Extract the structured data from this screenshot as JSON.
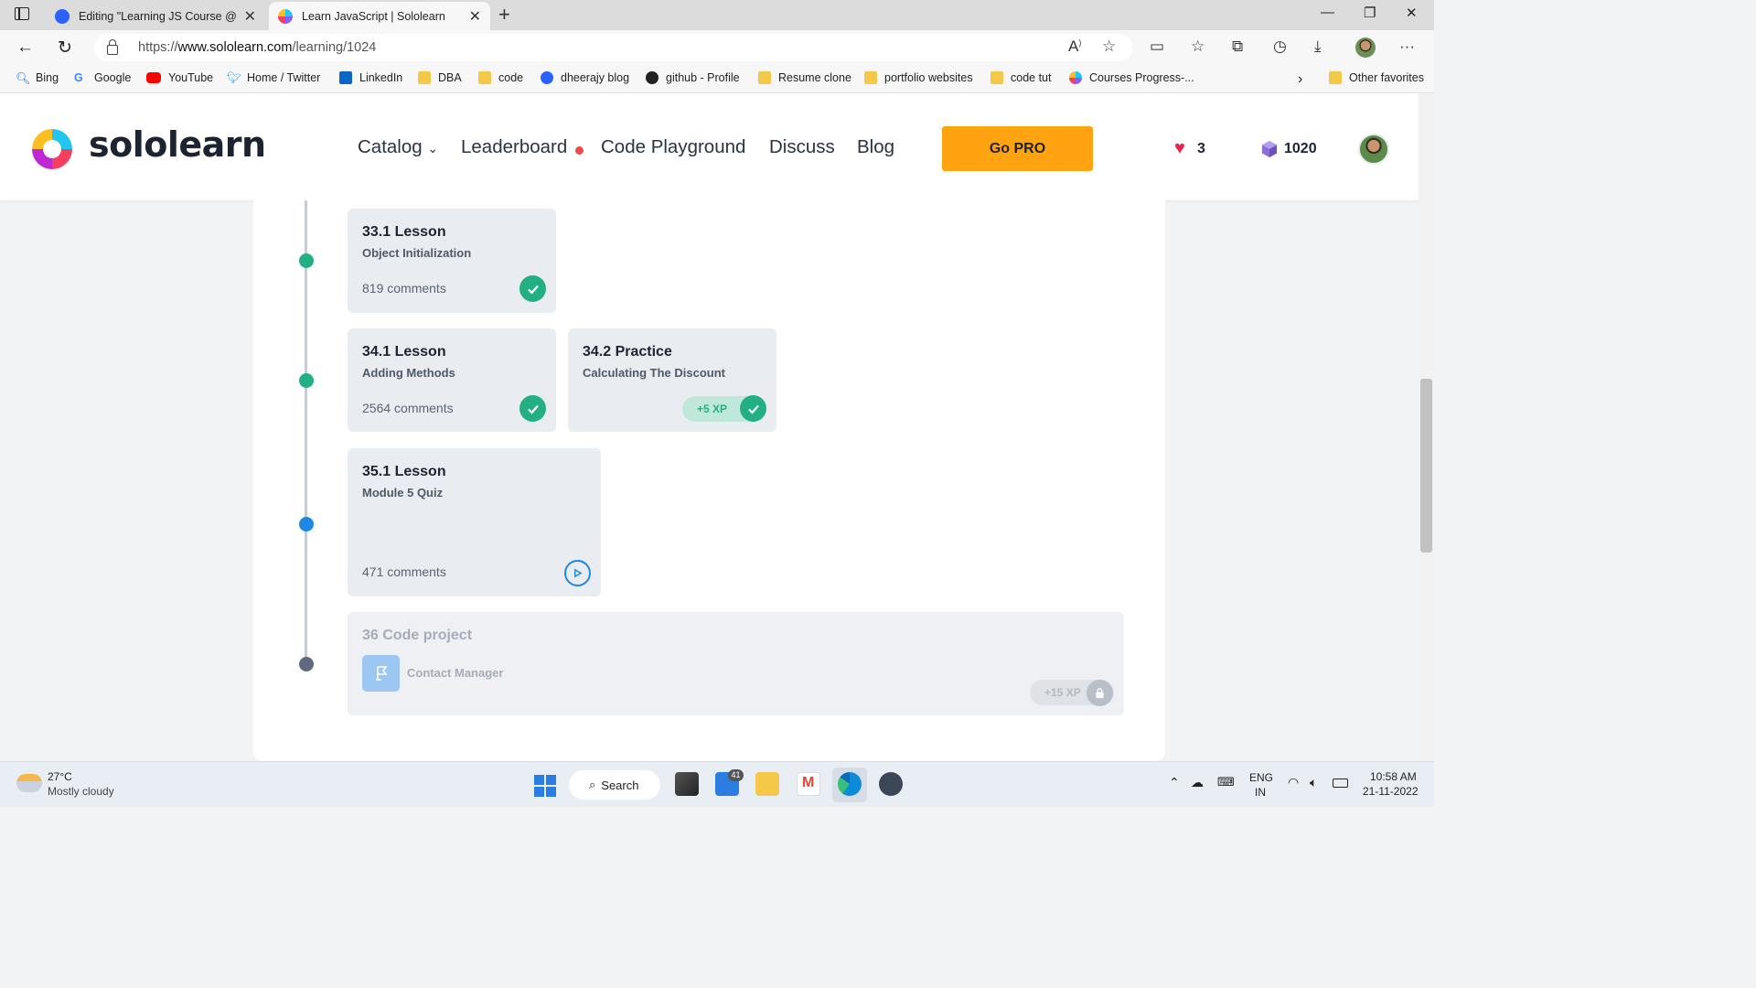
{
  "browser": {
    "tabs": [
      {
        "title": "Editing \"Learning JS Course @Sololearn\"",
        "active": false
      },
      {
        "title": "Learn JavaScript | Sololearn",
        "active": true
      }
    ],
    "url_scheme": "https://",
    "url_host": "www.sololearn.com",
    "url_path": "/learning/1024",
    "bookmarks": [
      "Bing",
      "Google",
      "YouTube",
      "Home / Twitter",
      "LinkedIn",
      "DBA",
      "code",
      "dheerajy blog",
      "github - Profile",
      "Resume clone",
      "portfolio websites",
      "code tut",
      "Courses Progress-...",
      "Other favorites"
    ]
  },
  "site": {
    "logo_text": "sololearn",
    "nav": {
      "catalog": "Catalog",
      "leaderboard": "Leaderboard",
      "code_playground": "Code Playground",
      "discuss": "Discuss",
      "blog": "Blog"
    },
    "go_pro": "Go PRO",
    "hearts": "3",
    "gems": "1020"
  },
  "lessons": {
    "l33_1": {
      "title": "33.1 Lesson",
      "subtitle": "Object Initialization",
      "comments": "819 comments"
    },
    "l34_1": {
      "title": "34.1 Lesson",
      "subtitle": "Adding Methods",
      "comments": "2564 comments"
    },
    "l34_2": {
      "title": "34.2 Practice",
      "subtitle": "Calculating The Discount",
      "xp": "+5 XP"
    },
    "l35_1": {
      "title": "35.1 Lesson",
      "subtitle": "Module 5 Quiz",
      "comments": "471 comments"
    },
    "p36": {
      "title": "36 Code project",
      "subtitle": "Contact Manager",
      "xp": "+15 XP"
    }
  },
  "colors": {
    "brand_orange": "#ffa310",
    "done_green": "#22b083",
    "active_blue": "#1e88e5",
    "locked_gray": "#5f6b7d"
  },
  "taskbar": {
    "weather_temp": "27°C",
    "weather_desc": "Mostly cloudy",
    "search_label": "Search",
    "mail_badge": "41",
    "lang_1": "ENG",
    "lang_2": "IN",
    "time": "10:58 AM",
    "date": "21-11-2022"
  }
}
